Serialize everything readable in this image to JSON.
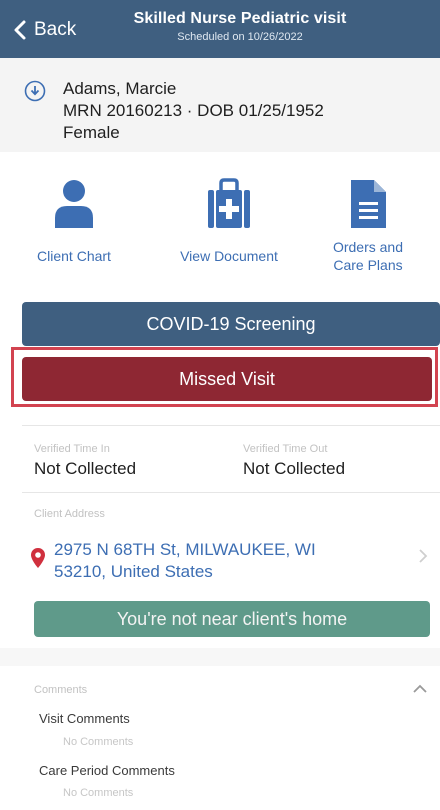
{
  "header": {
    "back_label": "Back",
    "title": "Skilled Nurse Pediatric visit",
    "subtitle": "Scheduled on 10/26/2022"
  },
  "patient": {
    "name": "Adams, Marcie",
    "mrn_dob": "MRN 20160213 · DOB 01/25/1952",
    "gender": "Female"
  },
  "actions": {
    "client_chart": "Client Chart",
    "view_document": "View Document",
    "orders_line1": "Orders and",
    "orders_line2": "Care Plans"
  },
  "buttons": {
    "covid": "COVID-19 Screening",
    "missed": "Missed Visit"
  },
  "time": {
    "in_label": "Verified Time In",
    "in_value": "Not Collected",
    "out_label": "Verified Time Out",
    "out_value": "Not Collected"
  },
  "address": {
    "label": "Client Address",
    "line1": "2975 N 68TH St, MILWAUKEE, WI",
    "line2": "53210, United States",
    "proximity": "You're not near client's home"
  },
  "comments": {
    "header": "Comments",
    "visit_label": "Visit Comments",
    "visit_value": "No Comments",
    "care_label": "Care Period Comments",
    "care_value": "No Comments"
  },
  "colors": {
    "header_bg": "#3f5f80",
    "accent_blue": "#3d6eb3",
    "missed_red": "#8e2733",
    "highlight_red": "#d24350",
    "proximity_green": "#5f9a8a",
    "pin_red": "#d0303e"
  },
  "icons": {
    "back": "chevron-left-icon",
    "download": "download-circle-icon",
    "client_chart": "person-icon",
    "view_document": "medical-bag-icon",
    "orders": "document-icon",
    "address": "map-pin-icon",
    "address_more": "chevron-right-icon",
    "comments_toggle": "chevron-up-icon"
  }
}
